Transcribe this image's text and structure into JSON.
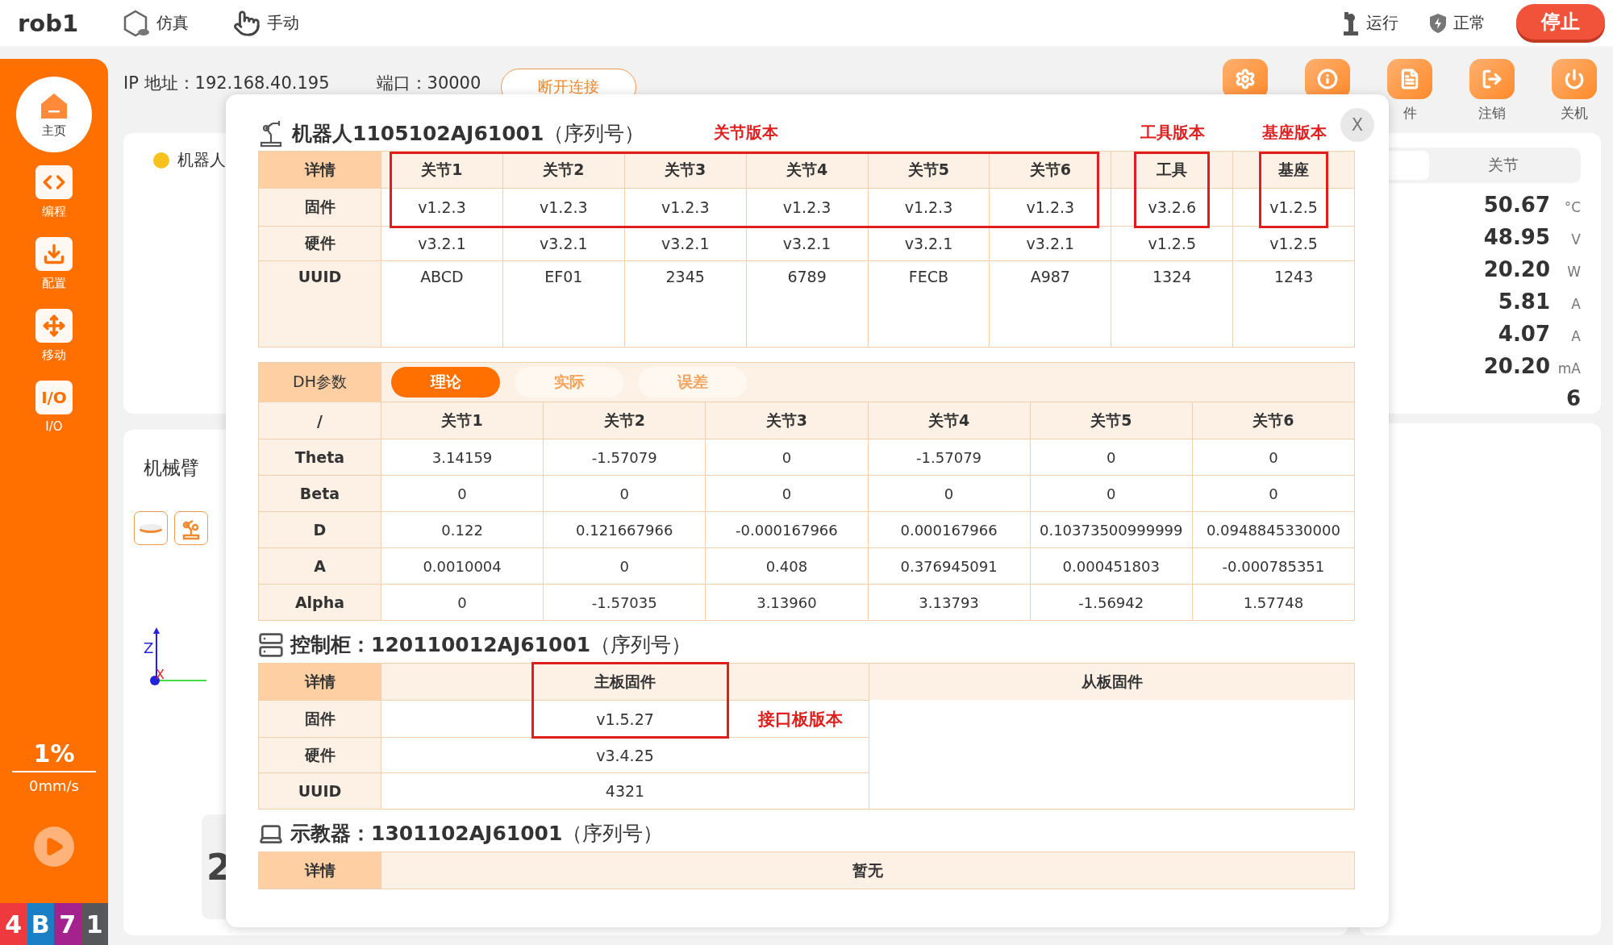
{
  "top_bar": {
    "title": "rob1",
    "modes": [
      {
        "label": "仿真",
        "kind": "sim"
      },
      {
        "label": "手动",
        "kind": "manual"
      }
    ],
    "status": [
      {
        "label": "运行",
        "kind": "robot"
      },
      {
        "label": "正常",
        "kind": "shield"
      }
    ],
    "stop_button": "停止"
  },
  "sidebar": {
    "items": [
      {
        "label": "主页",
        "kind": "home",
        "selected": true
      },
      {
        "label": "编程",
        "kind": "code",
        "selected": false
      },
      {
        "label": "配置",
        "kind": "config",
        "selected": false
      },
      {
        "label": "移动",
        "kind": "move",
        "selected": false
      },
      {
        "label": "I/O",
        "kind": "io",
        "glyph": "I/O",
        "selected": false
      }
    ],
    "speed": {
      "percent": "1%",
      "rate": "0mm/s"
    },
    "badges": [
      {
        "text": "4",
        "color": "#ee3a3f"
      },
      {
        "text": "B",
        "color": "#1b7fc5"
      },
      {
        "text": "7",
        "color": "#a4228e"
      },
      {
        "text": "1",
        "color": "#56575b"
      }
    ]
  },
  "connection": {
    "ip": "IP 地址：192.168.40.195",
    "port": "端口：30000",
    "button": "断开连接"
  },
  "toolbar": [
    {
      "kind": "settings"
    },
    {
      "kind": "info"
    },
    {
      "kind": "list",
      "label": "件"
    },
    {
      "kind": "logout",
      "label": "注销"
    },
    {
      "kind": "power",
      "label": "关机"
    }
  ],
  "robot_card": {
    "warning": "机器人"
  },
  "arm_card": {
    "title": "机械臂",
    "axis_labels": [
      "Z",
      "X"
    ],
    "big_value": "2"
  },
  "joint_panel": {
    "tab": "关节",
    "readings": [
      {
        "value": "50.67",
        "unit": "°C"
      },
      {
        "value": "48.95",
        "unit": "V"
      },
      {
        "value": "20.20",
        "unit": "W"
      },
      {
        "value": "5.81",
        "unit": "A"
      },
      {
        "value": "4.07",
        "unit": "A"
      },
      {
        "value": "20.20",
        "unit": "mA"
      },
      {
        "value": "6"
      }
    ]
  },
  "dialog": {
    "close": "X",
    "robot": {
      "title": "**机器人1105102AJ61001**（序列号）",
      "notes": [
        "关节版本",
        "工具版本",
        "基座版本"
      ],
      "corner": "详情",
      "columns": [
        "关节1",
        "关节2",
        "关节3",
        "关节4",
        "关节5",
        "关节6",
        "工具",
        "基座"
      ],
      "rows": [
        {
          "label": "固件",
          "cells": [
            "v1.2.3",
            "v1.2.3",
            "v1.2.3",
            "v1.2.3",
            "v1.2.3",
            "v1.2.3",
            "v3.2.6",
            "v1.2.5"
          ]
        },
        {
          "label": "硬件",
          "cells": [
            "v3.2.1",
            "v3.2.1",
            "v3.2.1",
            "v3.2.1",
            "v3.2.1",
            "v3.2.1",
            "v1.2.5",
            "v1.2.5"
          ]
        },
        {
          "label": "UUID",
          "cells": [
            "ABCD",
            "EF01",
            "2345",
            "6789",
            "FECB",
            "A987",
            "1324",
            "1243"
          ]
        }
      ]
    },
    "dh": {
      "label": "DH参数",
      "tabs": [
        {
          "label": "理论",
          "selected": true
        },
        {
          "label": "实际",
          "selected": false
        },
        {
          "label": "误差",
          "selected": false
        }
      ],
      "corner": "/",
      "columns": [
        "关节1",
        "关节2",
        "关节3",
        "关节4",
        "关节5",
        "关节6"
      ],
      "rows": [
        {
          "label": "Theta",
          "cells": [
            "3.14159",
            "-1.57079",
            "0",
            "-1.57079",
            "0",
            "0"
          ]
        },
        {
          "label": "Beta",
          "cells": [
            "0",
            "0",
            "0",
            "0",
            "0",
            "0"
          ]
        },
        {
          "label": "D",
          "cells": [
            "0.122",
            "0.121667966",
            "-0.000167966",
            "0.000167966",
            "0.10373500999999",
            "0.0948845330000"
          ]
        },
        {
          "label": "A",
          "cells": [
            "0.0010004",
            "0",
            "0.408",
            "0.376945091",
            "0.000451803",
            "-0.000785351"
          ]
        },
        {
          "label": "Alpha",
          "cells": [
            "0",
            "-1.57035",
            "3.13960",
            "3.13793",
            "-1.56942",
            "1.57748"
          ]
        }
      ]
    },
    "cabinet": {
      "title": "**控制柜：120110012AJ61001**（序列号）",
      "note": "接口板版本",
      "corner": "详情",
      "columns": [
        "主板固件",
        "从板固件"
      ],
      "rows": [
        {
          "label": "固件",
          "cells": [
            "v1.5.27"
          ]
        },
        {
          "label": "硬件",
          "cells": [
            "v3.4.25"
          ]
        },
        {
          "label": "UUID",
          "cells": [
            "4321"
          ]
        }
      ]
    },
    "pendant": {
      "title": "**示教器：1301102AJ61001**（序列号）",
      "label": "详情",
      "value": "暂无"
    }
  }
}
